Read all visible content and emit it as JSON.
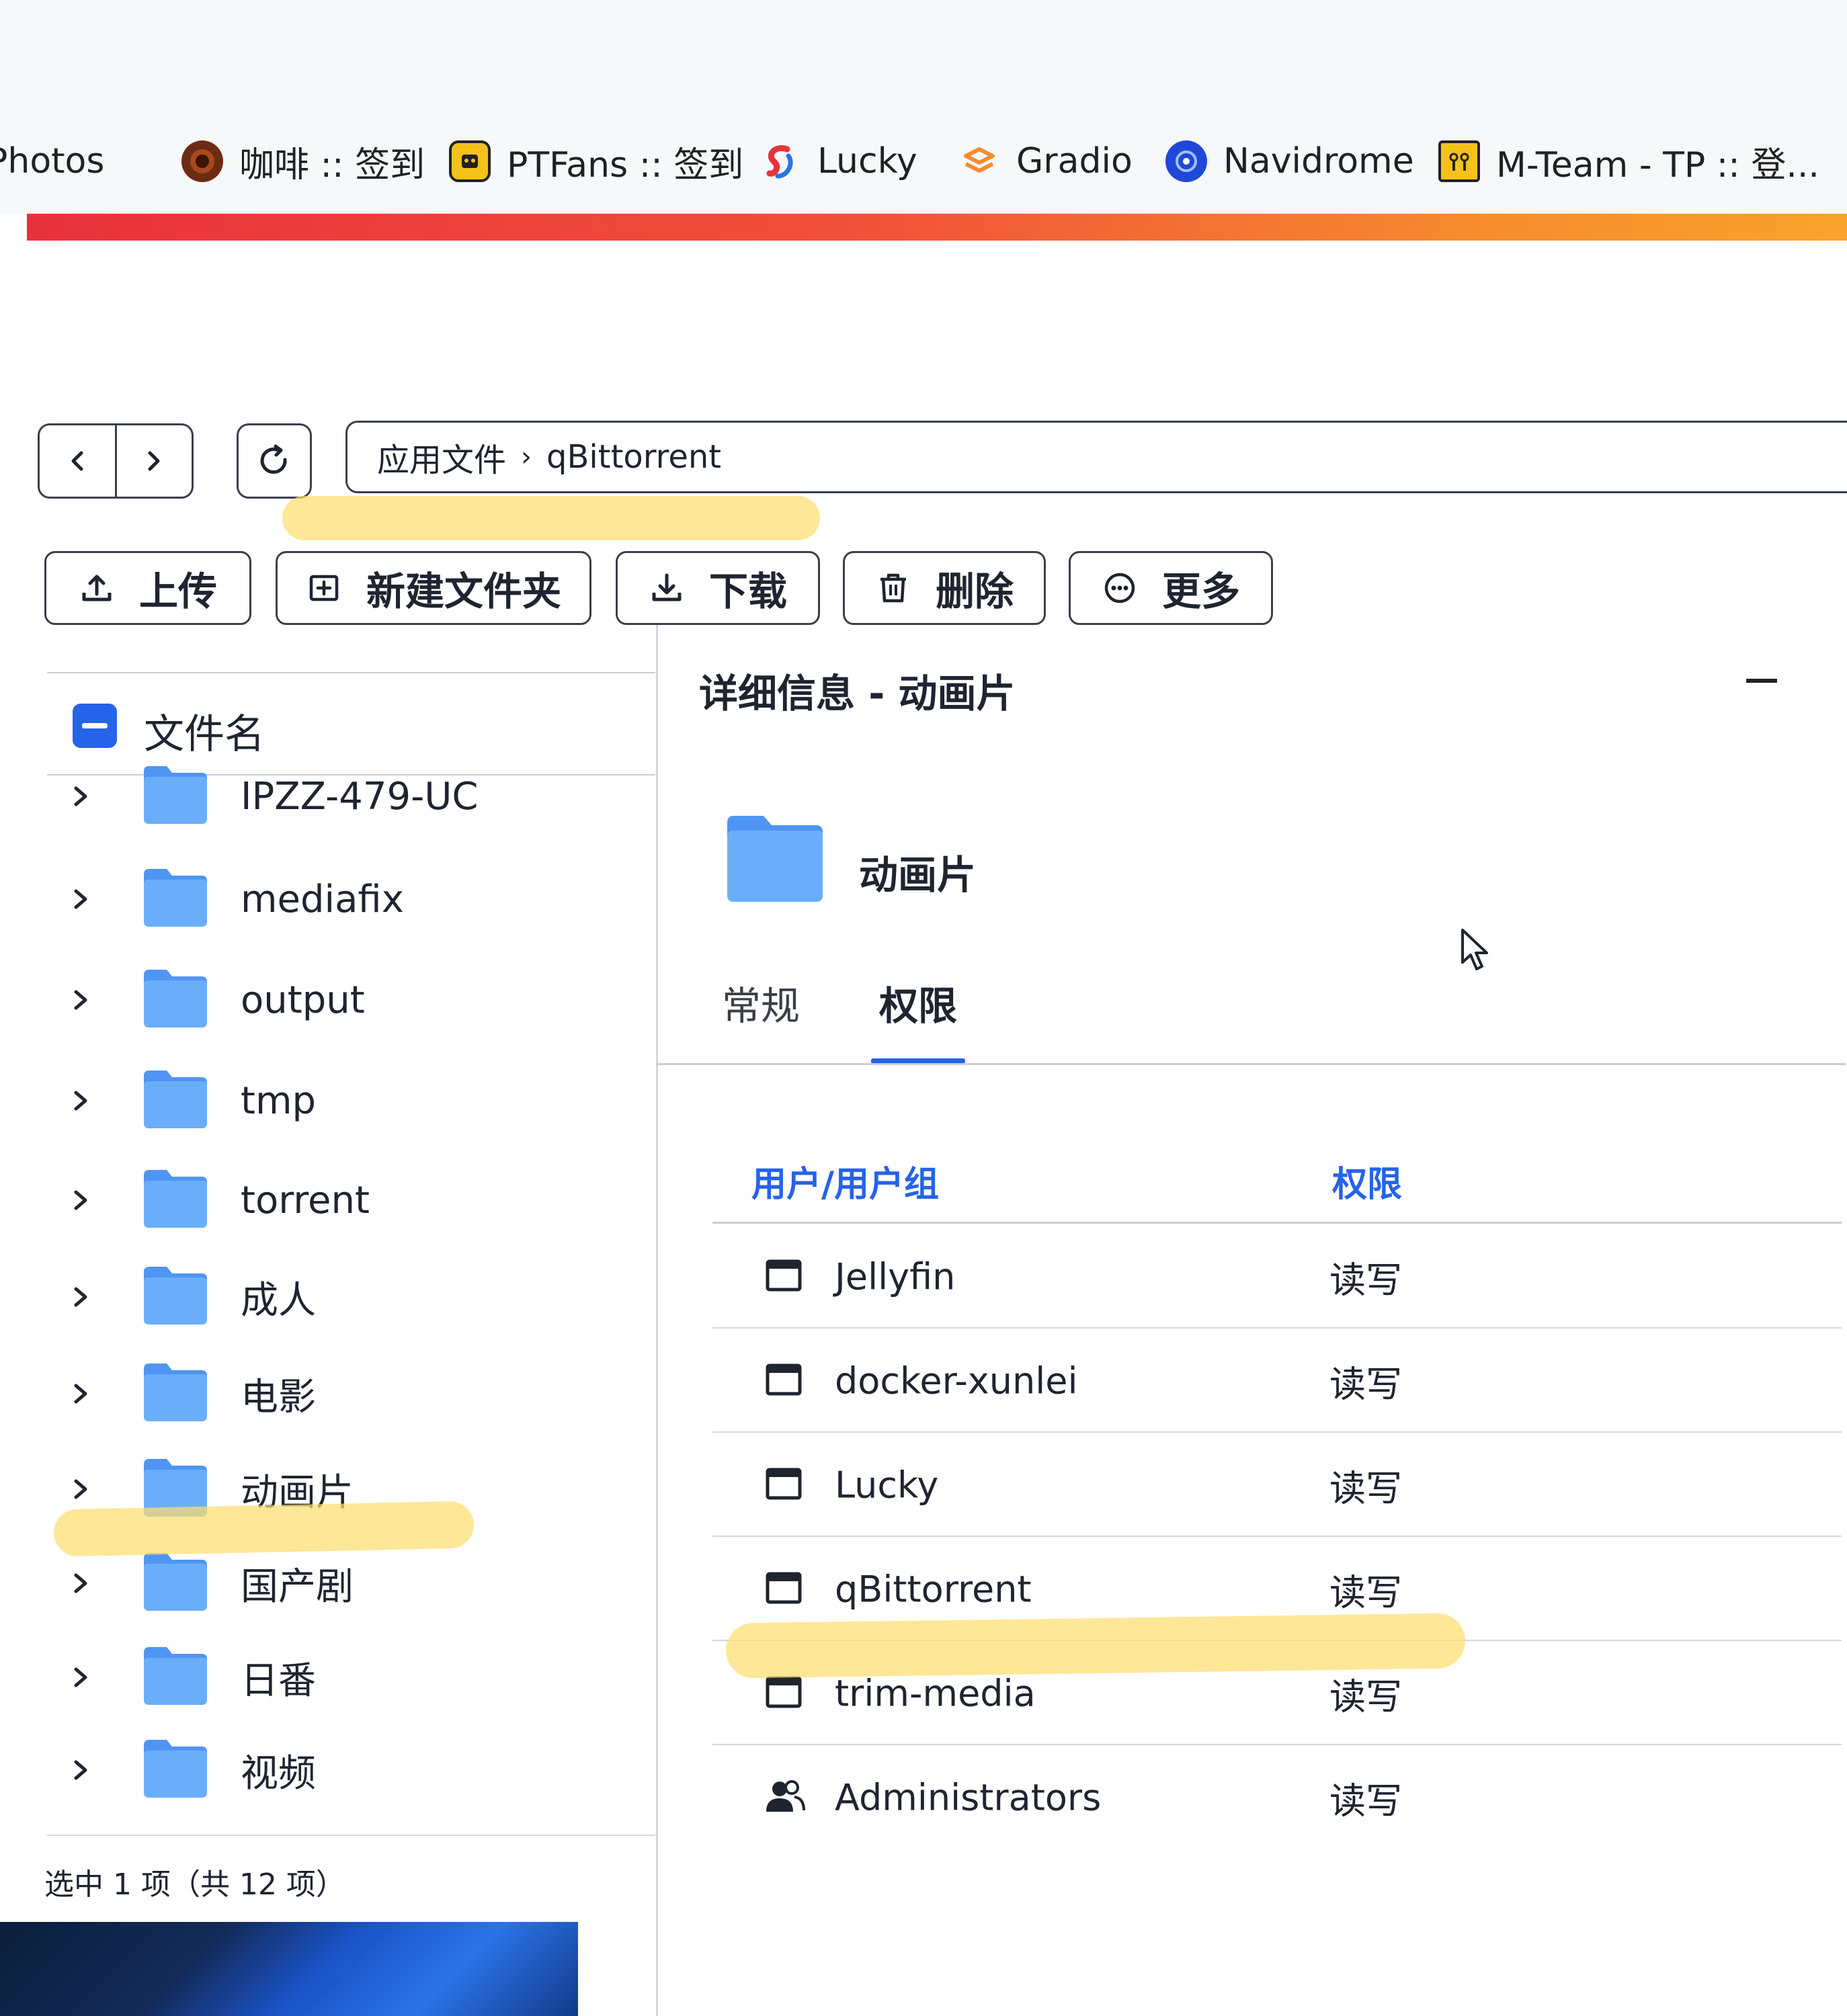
{
  "bookmarks": {
    "items": [
      {
        "label": "Photos",
        "icon": "photos-icon"
      },
      {
        "label": "咖啡 :: 签到",
        "icon": "coffee-site-icon"
      },
      {
        "label": "PTFans :: 签到",
        "icon": "ptfans-icon"
      },
      {
        "label": "Lucky",
        "icon": "lucky-icon"
      },
      {
        "label": "Gradio",
        "icon": "gradio-icon"
      },
      {
        "label": "Navidrome",
        "icon": "navidrome-icon"
      },
      {
        "label": "M-Team - TP :: 登...",
        "icon": "mteam-icon"
      }
    ]
  },
  "colors": {
    "accent_gradient_start": "#e8323c",
    "accent_gradient_end": "#f9a32c",
    "primary_blue": "#2563e8",
    "highlighter": "#fdde6e"
  },
  "nav": {
    "back_icon": "chevron-left-icon",
    "forward_icon": "chevron-right-icon",
    "refresh_icon": "refresh-icon",
    "breadcrumb": [
      "应用文件",
      "qBittorrent"
    ]
  },
  "toolbar": {
    "upload": "上传",
    "new_folder": "新建文件夹",
    "download": "下载",
    "delete": "删除",
    "more": "更多"
  },
  "file_list": {
    "header": "文件名",
    "items": [
      {
        "name": "IPZZ-479-UC"
      },
      {
        "name": "mediafix"
      },
      {
        "name": "output"
      },
      {
        "name": "tmp"
      },
      {
        "name": "torrent"
      },
      {
        "name": "成人"
      },
      {
        "name": "电影"
      },
      {
        "name": "动画片",
        "selected": true
      },
      {
        "name": "国产剧"
      },
      {
        "name": "日番"
      },
      {
        "name": "视频"
      }
    ],
    "status": "选中 1 项（共 12 项）"
  },
  "details": {
    "title": "详细信息 - 动画片",
    "folder_name": "动画片",
    "tabs": [
      "常规",
      "权限"
    ],
    "active_tab": "权限",
    "columns": {
      "user": "用户/用户组",
      "permission": "权限"
    },
    "rows": [
      {
        "name": "Jellyfin",
        "perm": "读写",
        "type": "app"
      },
      {
        "name": "docker-xunlei",
        "perm": "读写",
        "type": "app"
      },
      {
        "name": "Lucky",
        "perm": "读写",
        "type": "app"
      },
      {
        "name": "qBittorrent",
        "perm": "读写",
        "type": "app"
      },
      {
        "name": "trim-media",
        "perm": "读写",
        "type": "app"
      },
      {
        "name": "Administrators",
        "perm": "读写",
        "type": "group"
      }
    ]
  }
}
